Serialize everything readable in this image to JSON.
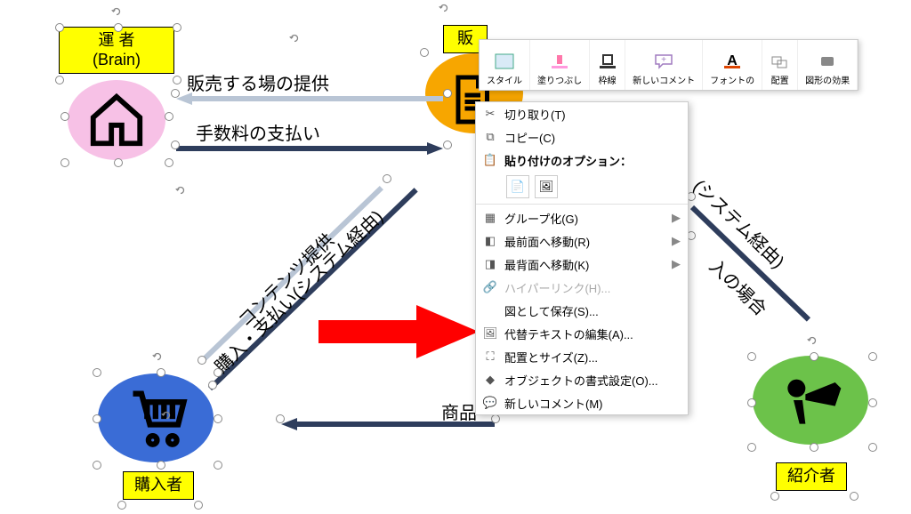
{
  "nodes": {
    "operator": {
      "line1": "運 者",
      "line2": "(Brain)"
    },
    "seller_prefix": "販",
    "buyer": "購入者",
    "referrer": "紹介者"
  },
  "arrows": {
    "provide_place": "販売する場の提供",
    "fee_payment": "手数料の支払い",
    "content_provide": "コンテンツ提供",
    "purchase_via_system": "購入・支払い(システム経由)",
    "via_system_right": "(システム経由)",
    "if_purchase": "入の場合",
    "product": "商品"
  },
  "mini_toolbar": {
    "style": "スタイル",
    "fill": "塗りつぶし",
    "outline": "枠線",
    "new_comment": "新しいコメント",
    "font": "フォントの",
    "arrange": "配置",
    "effects": "図形の効果"
  },
  "context_menu": {
    "cut": "切り取り(T)",
    "copy": "コピー(C)",
    "paste_header": "貼り付けのオプション：",
    "group": "グループ化(G)",
    "bring_front": "最前面へ移動(R)",
    "send_back": "最背面へ移動(K)",
    "hyperlink": "ハイパーリンク(H)...",
    "save_as_picture": "図として保存(S)...",
    "alt_text": "代替テキストの編集(A)...",
    "size_position": "配置とサイズ(Z)...",
    "format_object": "オブジェクトの書式設定(O)...",
    "new_comment": "新しいコメント(M)"
  }
}
